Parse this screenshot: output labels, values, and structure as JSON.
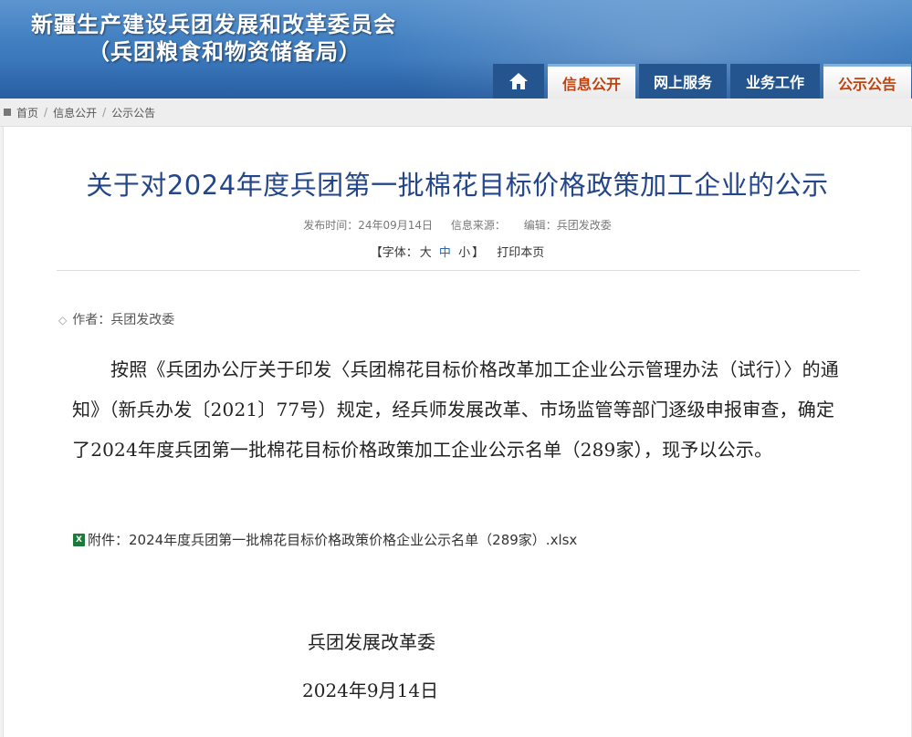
{
  "header": {
    "title": "新疆生产建设兵团发展和改革委员会",
    "subtitle": "（兵团粮食和物资储备局）",
    "accent_color": "#3f7dc0"
  },
  "nav": {
    "home_icon": "home-icon",
    "items": [
      {
        "label": "信息公开",
        "active": true
      },
      {
        "label": "网上服务",
        "active": false
      },
      {
        "label": "业务工作",
        "active": false
      },
      {
        "label": "公示公告",
        "active": true
      }
    ]
  },
  "breadcrumb": [
    "首页",
    "信息公开",
    "公示公告"
  ],
  "article": {
    "title": "关于对2024年度兵团第一批棉花目标价格政策加工企业的公示",
    "meta": {
      "publish_time": "发布时间：24年09月14日",
      "source": "信息来源：",
      "editor": "编辑：兵团发改委"
    },
    "font_size": {
      "label_open": "【字体：",
      "large": "大",
      "medium": "中",
      "small": "小",
      "label_close": "】",
      "print": "打印本页"
    },
    "author": "作者：兵团发改委",
    "body": "按照《兵团办公厅关于印发〈兵团棉花目标价格改革加工企业公示管理办法（试行）〉的通知》（新兵办发〔2021〕77号）规定，经兵师发展改革、市场监管等部门逐级申报审查，确定了2024年度兵团第一批棉花目标价格政策加工企业公示名单（289家），现予以公示。",
    "attachment": "附件：2024年度兵团第一批棉花目标价格政策价格企业公示名单（289家）.xlsx",
    "signature_org": "兵团发展改革委",
    "signature_date": "2024年9月14日"
  }
}
